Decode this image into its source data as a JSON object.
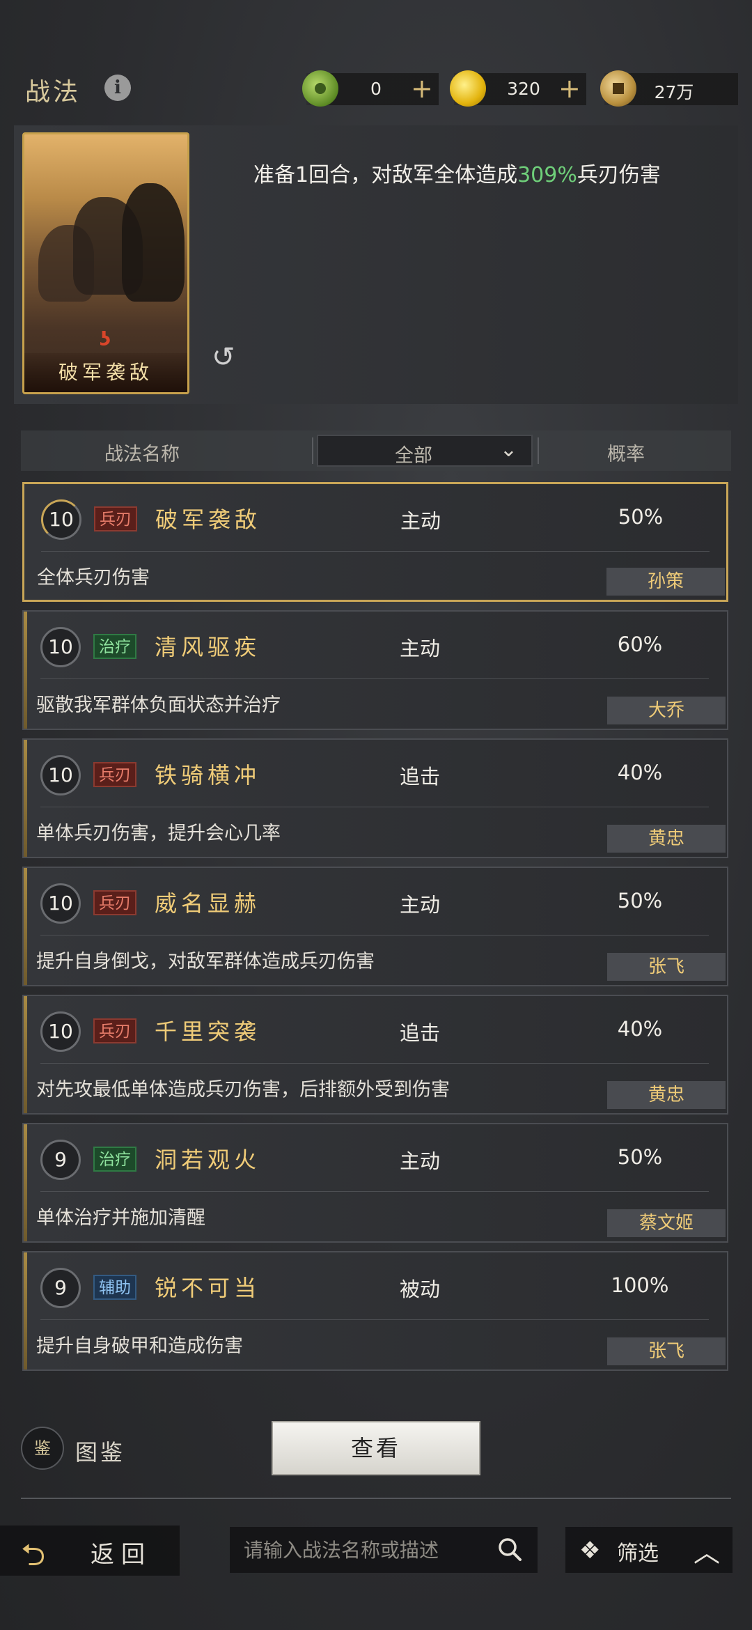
{
  "header": {
    "title": "战法",
    "currencies": [
      {
        "icon": "jade-icon",
        "value": "0",
        "has_plus": true
      },
      {
        "icon": "gold-icon",
        "value": "320",
        "has_plus": true
      },
      {
        "icon": "copper-icon",
        "value": "27万",
        "has_plus": false
      }
    ]
  },
  "selected": {
    "card_name": "破军袭敌",
    "desc_prefix": "准备1回合，对敌军全体造成",
    "desc_highlight": "309%",
    "desc_suffix": "兵刃伤害",
    "highlight_color": "#6fcf7a"
  },
  "table": {
    "col_name": "战法名称",
    "filter_value": "全部",
    "col_prob": "概率"
  },
  "skills": [
    {
      "level": "10",
      "tag": "兵刃",
      "tag_type": "blade",
      "name": "破军袭敌",
      "type": "主动",
      "prob": "50%",
      "desc": "全体兵刃伤害",
      "owner": "孙策"
    },
    {
      "level": "10",
      "tag": "治疗",
      "tag_type": "heal",
      "name": "清风驱疾",
      "type": "主动",
      "prob": "60%",
      "desc": "驱散我军群体负面状态并治疗",
      "owner": "大乔"
    },
    {
      "level": "10",
      "tag": "兵刃",
      "tag_type": "blade",
      "name": "铁骑横冲",
      "type": "追击",
      "prob": "40%",
      "desc": "单体兵刃伤害，提升会心几率",
      "owner": "黄忠"
    },
    {
      "level": "10",
      "tag": "兵刃",
      "tag_type": "blade",
      "name": "威名显赫",
      "type": "主动",
      "prob": "50%",
      "desc": "提升自身倒戈，对敌军群体造成兵刃伤害",
      "owner": "张飞"
    },
    {
      "level": "10",
      "tag": "兵刃",
      "tag_type": "blade",
      "name": "千里突袭",
      "type": "追击",
      "prob": "40%",
      "desc": "对先攻最低单体造成兵刃伤害，后排额外受到伤害",
      "owner": "黄忠"
    },
    {
      "level": "9",
      "tag": "治疗",
      "tag_type": "heal",
      "name": "洞若观火",
      "type": "主动",
      "prob": "50%",
      "desc": "单体治疗并施加清醒",
      "owner": "蔡文姬"
    },
    {
      "level": "9",
      "tag": "辅助",
      "tag_type": "aux",
      "name": "锐不可当",
      "type": "被动",
      "prob": "100%",
      "desc": "提升自身破甲和造成伤害",
      "owner": "张飞"
    }
  ],
  "footer": {
    "atlas_icon_glyph": "鉴",
    "atlas_label": "图鉴",
    "view_button": "查看",
    "back_label": "返回",
    "search_placeholder": "请输入战法名称或描述",
    "filter_label": "筛选"
  }
}
